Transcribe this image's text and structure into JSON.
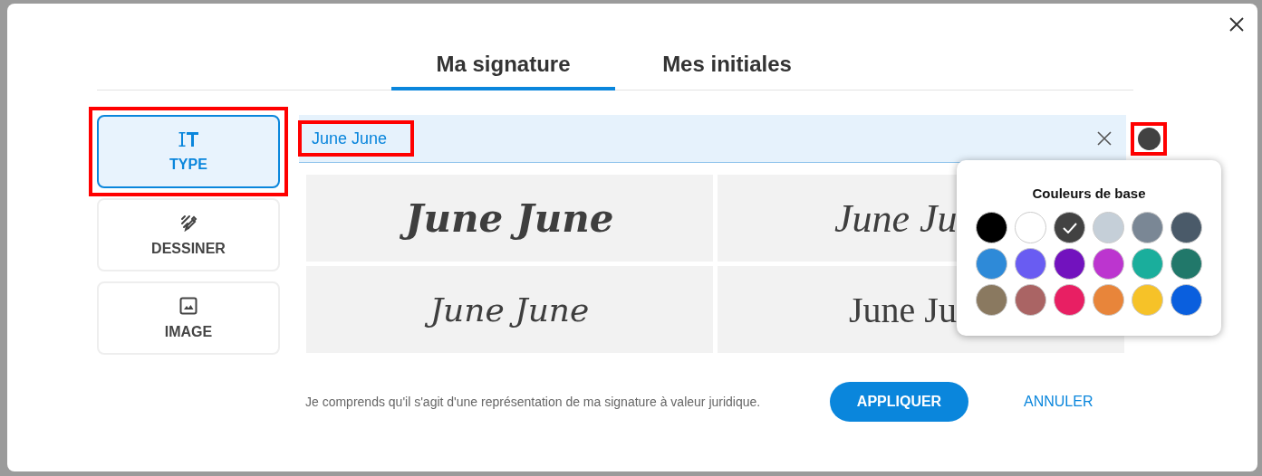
{
  "tabs": [
    {
      "label": "Ma signature",
      "selected": true
    },
    {
      "label": "Mes initiales",
      "selected": false
    }
  ],
  "modes": [
    {
      "kind": "type",
      "label": "TYPE",
      "selected": true,
      "highlighted": true
    },
    {
      "kind": "draw",
      "label": "DESSINER",
      "selected": false,
      "highlighted": false
    },
    {
      "kind": "image",
      "label": "IMAGE",
      "selected": false,
      "highlighted": false
    }
  ],
  "name_field": {
    "value": "June June",
    "highlighted": true
  },
  "color_button": {
    "color": "#424242",
    "highlighted": true
  },
  "signatures": [
    {
      "kind": "bold-script",
      "text": "June June",
      "clipped": false
    },
    {
      "kind": "script",
      "text": "June Ju",
      "clipped": true
    },
    {
      "kind": "thin-script",
      "text": "June June",
      "clipped": false
    },
    {
      "kind": "serif",
      "text": "June Ju",
      "clipped": true
    }
  ],
  "color_popover": {
    "title": "Couleurs de base",
    "swatches": [
      {
        "color": "#000000",
        "selected": false
      },
      {
        "color": "#ffffff",
        "selected": false
      },
      {
        "color": "#424242",
        "selected": true
      },
      {
        "color": "#c5cfd8",
        "selected": false
      },
      {
        "color": "#7a8795",
        "selected": false
      },
      {
        "color": "#4a5a69",
        "selected": false
      },
      {
        "color": "#2e8ad8",
        "selected": false
      },
      {
        "color": "#695cf2",
        "selected": false
      },
      {
        "color": "#7212be",
        "selected": false
      },
      {
        "color": "#bc35cf",
        "selected": false
      },
      {
        "color": "#1aae9c",
        "selected": false
      },
      {
        "color": "#21786a",
        "selected": false
      },
      {
        "color": "#8a7960",
        "selected": false
      },
      {
        "color": "#aa6464",
        "selected": false
      },
      {
        "color": "#e81f63",
        "selected": false
      },
      {
        "color": "#e8853a",
        "selected": false
      },
      {
        "color": "#f6c228",
        "selected": false
      },
      {
        "color": "#0a5fde",
        "selected": false
      }
    ]
  },
  "footer": {
    "notice": "Je comprends qu'il s'agit d'une représentation de ma signature à valeur juridique.",
    "apply": "APPLIQUER",
    "cancel": "ANNULER"
  }
}
